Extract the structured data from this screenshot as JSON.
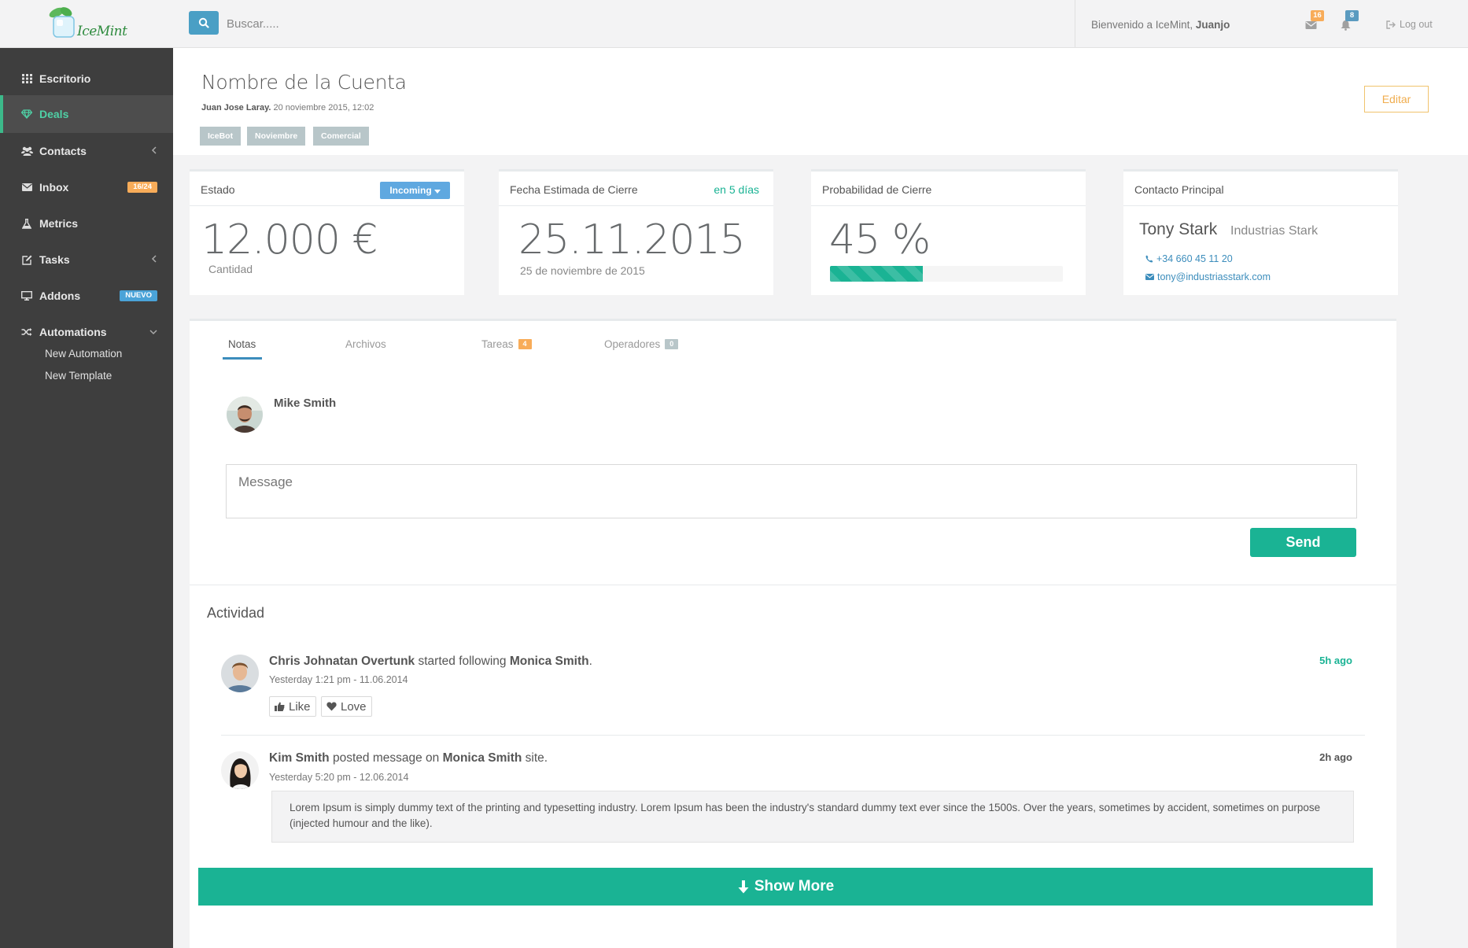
{
  "brand": {
    "logo_text": "IceMint"
  },
  "search": {
    "placeholder": "Buscar....."
  },
  "topbar": {
    "welcome_prefix": "Bienvenido a IceMint,",
    "user": "Juanjo",
    "mail_count": "16",
    "notif_count": "8",
    "logout": "Log out"
  },
  "sidebar": {
    "items": [
      {
        "label": "Escritorio",
        "icon": "grid-icon"
      },
      {
        "label": "Deals",
        "icon": "diamond-icon"
      },
      {
        "label": "Contacts",
        "icon": "users-icon"
      },
      {
        "label": "Inbox",
        "icon": "envelope-icon",
        "badge": "16/24"
      },
      {
        "label": "Metrics",
        "icon": "flask-icon"
      },
      {
        "label": "Tasks",
        "icon": "edit-icon"
      },
      {
        "label": "Addons",
        "icon": "desktop-icon",
        "badge": "NUEVO"
      },
      {
        "label": "Automations",
        "icon": "shuffle-icon"
      }
    ],
    "subitems": [
      "New Automation",
      "New Template"
    ]
  },
  "account": {
    "title": "Nombre de la Cuenta",
    "author": "Juan Jose Laray.",
    "date": "20 noviembre 2015, 12:02",
    "tags": [
      "IceBot",
      "Noviembre",
      "Comercial"
    ],
    "edit_label": "Editar"
  },
  "cards": {
    "estado": {
      "title": "Estado",
      "status": "Incoming",
      "amount": "12.000 €",
      "sub": "Cantidad"
    },
    "fecha": {
      "title": "Fecha Estimada de Cierre",
      "right": "en 5 días",
      "date": "25.11.2015",
      "sub": "25 de noviembre de 2015"
    },
    "probabilidad": {
      "title": "Probabilidad de Cierre",
      "value": "45 %",
      "progress": 0.4
    },
    "contacto": {
      "title": "Contacto Principal",
      "name": "Tony Stark",
      "company": "Industrias Stark",
      "phone": "+34 660 45 11 20",
      "email": "tony@industriasstark.com"
    }
  },
  "tabs": [
    {
      "label": "Notas"
    },
    {
      "label": "Archivos"
    },
    {
      "label": "Tareas",
      "badge": "4"
    },
    {
      "label": "Operadores",
      "badge": "0"
    }
  ],
  "note": {
    "author": "Mike Smith"
  },
  "compose": {
    "placeholder": "Message",
    "send_label": "Send"
  },
  "activity": {
    "title": "Actividad",
    "items": [
      {
        "actor": "Chris Johnatan Overtunk",
        "verb": "started following",
        "target": "Monica Smith",
        "suffix": ".",
        "time": "Yesterday 1:21 pm - 11.06.2014",
        "ago": "5h ago",
        "like_label": "Like",
        "love_label": "Love"
      },
      {
        "actor": "Kim Smith",
        "verb": "posted message on",
        "target": "Monica Smith",
        "suffix": "site.",
        "time": "Yesterday 5:20 pm - 12.06.2014",
        "ago": "2h ago",
        "message": "Lorem Ipsum is simply dummy text of the printing and typesetting industry. Lorem Ipsum has been the industry's standard dummy text ever since the 1500s. Over the years, sometimes by accident, sometimes on purpose (injected humour and the like)."
      }
    ],
    "show_more": "Show More"
  },
  "colors": {
    "accent": "#1ab394",
    "sidebar_bg": "#3e3e3e",
    "link": "#3c8dbc",
    "warning": "#f0ad4e",
    "incoming": "#5fa8e0"
  }
}
